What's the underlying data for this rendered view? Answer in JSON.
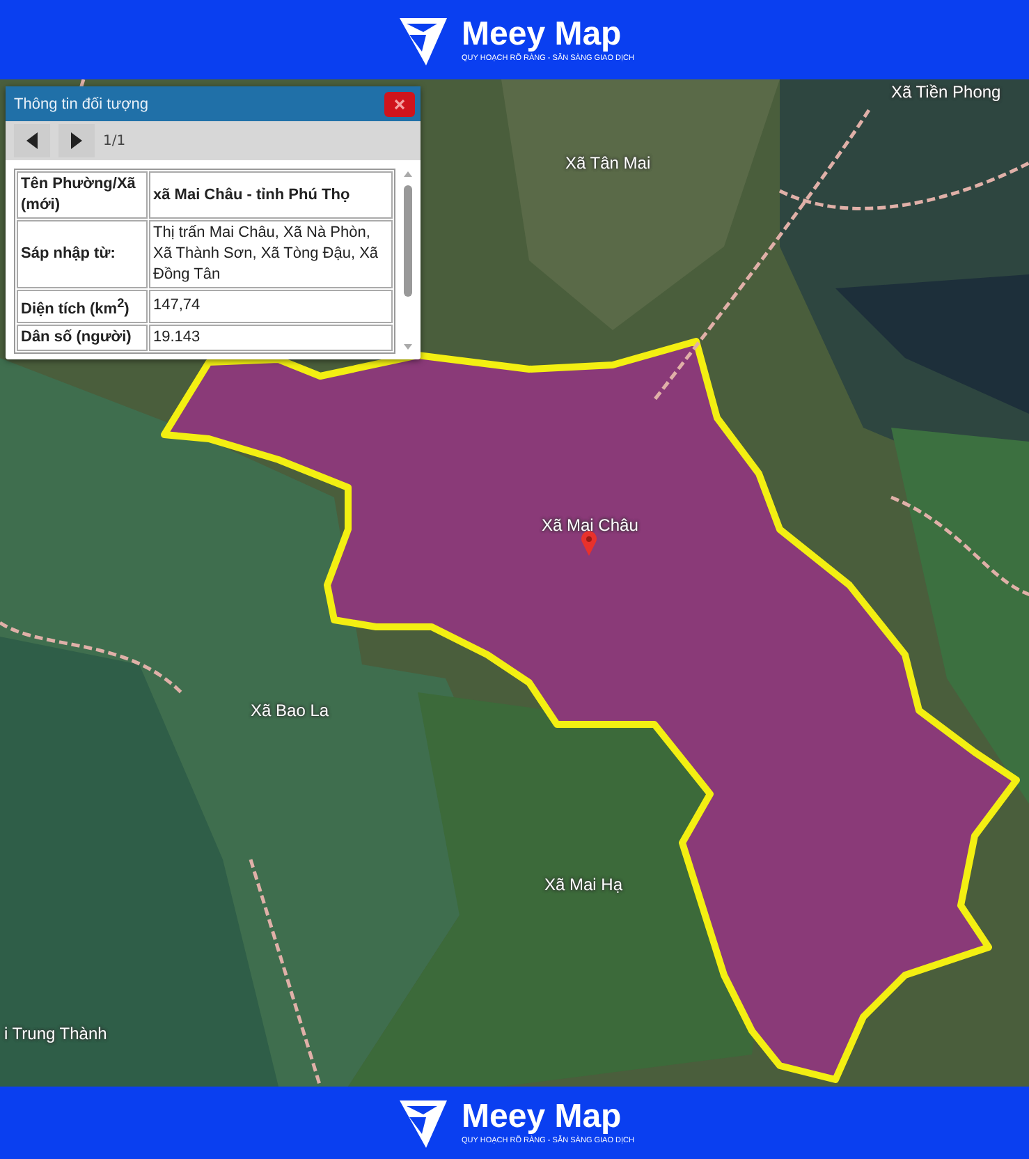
{
  "header": {
    "brand": "Meey Map",
    "tagline": "QUY HOẠCH RÕ RÀNG - SẴN SÀNG GIAO DỊCH"
  },
  "map": {
    "labels": [
      {
        "text": "Xã Tiền Phong"
      },
      {
        "text": "Xã Tân Mai"
      },
      {
        "text": "Xã Mai Châu"
      },
      {
        "text": "Xã Bao La"
      },
      {
        "text": "Xã Mai Hạ"
      },
      {
        "text": "i Trung Thành"
      }
    ]
  },
  "popup": {
    "title": "Thông tin đối tượng",
    "pager": "1/1",
    "rows": [
      {
        "label": "Tên Phường/Xã (mới)",
        "value": "xã Mai Châu - tỉnh Phú Thọ",
        "bold_value": true
      },
      {
        "label": "Sáp nhập từ:",
        "value": "Thị trấn Mai Châu, Xã Nà Phòn, Xã Thành Sơn, Xã Tòng Đậu, Xã Đồng Tân",
        "bold_value": false
      },
      {
        "label": "Diện tích (km$^{2}$)",
        "value": "147,74",
        "bold_value": false
      },
      {
        "label": "Dân số (người)",
        "value": "19.143",
        "bold_value": false
      }
    ]
  },
  "footer": {
    "brand": "Meey Map",
    "tagline": "QUY HOẠCH RÕ RÀNG - SẴN SÀNG GIAO DỊCH"
  }
}
